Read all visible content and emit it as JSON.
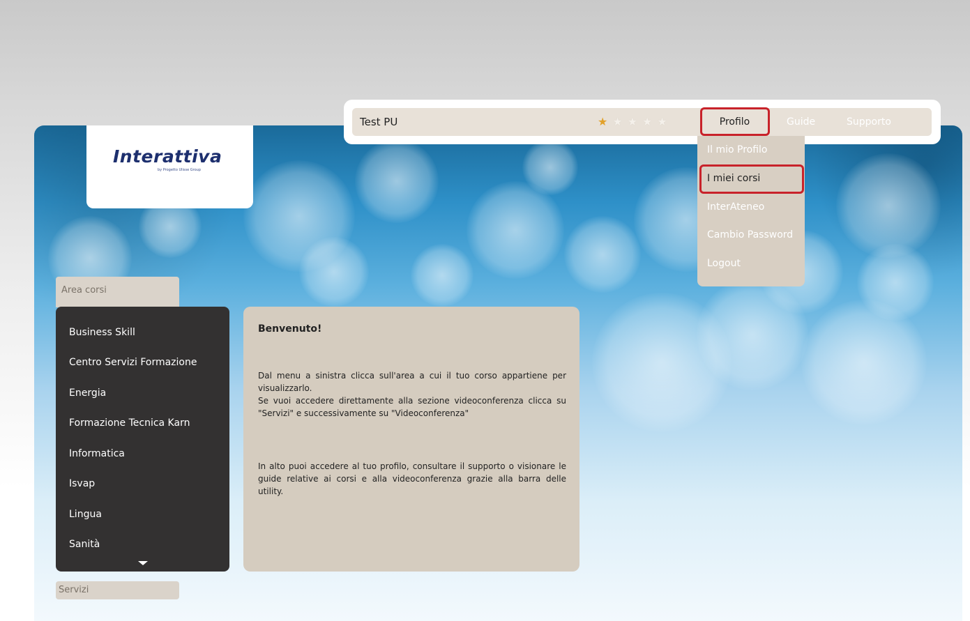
{
  "brand": {
    "logo_text": "Interattiva",
    "logo_subtext": "by Progetto Ulisse Group"
  },
  "topbar": {
    "user_name": "Test PU",
    "rating": {
      "value": 0.5,
      "max": 5
    },
    "nav": {
      "profilo": "Profilo",
      "guide": "Guide",
      "supporto": "Supporto"
    }
  },
  "profile_dropdown": {
    "items": [
      "Il mio Profilo",
      "I miei corsi",
      "InterAteneo",
      "Cambio Password",
      "Logout"
    ]
  },
  "sidebar": {
    "area_label": "Area corsi",
    "items": [
      "Business Skill",
      "Centro Servizi Formazione",
      "Energia",
      "Formazione Tecnica Karn",
      "Informatica",
      "Isvap",
      "Lingua",
      "Sanità"
    ],
    "servizi_label": "Servizi"
  },
  "welcome": {
    "title": "Benvenuto!",
    "paragraph1": "Dal menu a sinistra clicca sull'area a cui il tuo corso appartiene per visualizzarlo.\nSe vuoi accedere direttamente alla sezione videoconferenza clicca su \"Servizi\" e successivamente su \"Videoconferenza\"",
    "paragraph2": "In alto puoi accedere al tuo profilo, consultare il supporto o visionare le guide relative ai corsi e alla videoconferenza grazie alla barra delle utility."
  },
  "colors": {
    "highlight": "#c8222a",
    "menu_bg": "#333131",
    "panel_bg": "#d5ccbf",
    "dropdown_bg": "#d8cfc3",
    "star_active": "#e2a12a"
  }
}
